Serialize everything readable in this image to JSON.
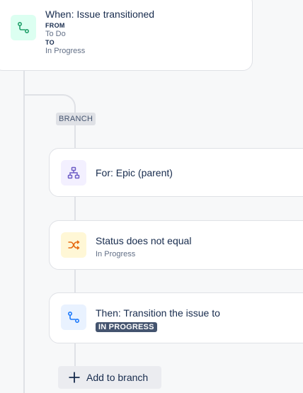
{
  "trigger": {
    "title": "When: Issue transitioned",
    "from_label": "FROM",
    "from_value": "To Do",
    "to_label": "TO",
    "to_value": "In Progress",
    "icon": "transition-icon"
  },
  "branch": {
    "badge": "BRANCH"
  },
  "steps": [
    {
      "title": "For: Epic (parent)",
      "icon": "hierarchy-icon"
    },
    {
      "title": "Status does not equal",
      "subtitle": "In Progress",
      "icon": "shuffle-icon"
    },
    {
      "title": "Then: Transition the issue to",
      "lozenge": "IN PROGRESS",
      "icon": "transition-icon"
    }
  ],
  "add_branch": {
    "label": "Add to branch"
  },
  "colors": {
    "green": "#22a06b",
    "purple": "#6e5dc6",
    "orange": "#e56910",
    "blue": "#1d7afc",
    "lozenge_bg": "#44546f"
  }
}
